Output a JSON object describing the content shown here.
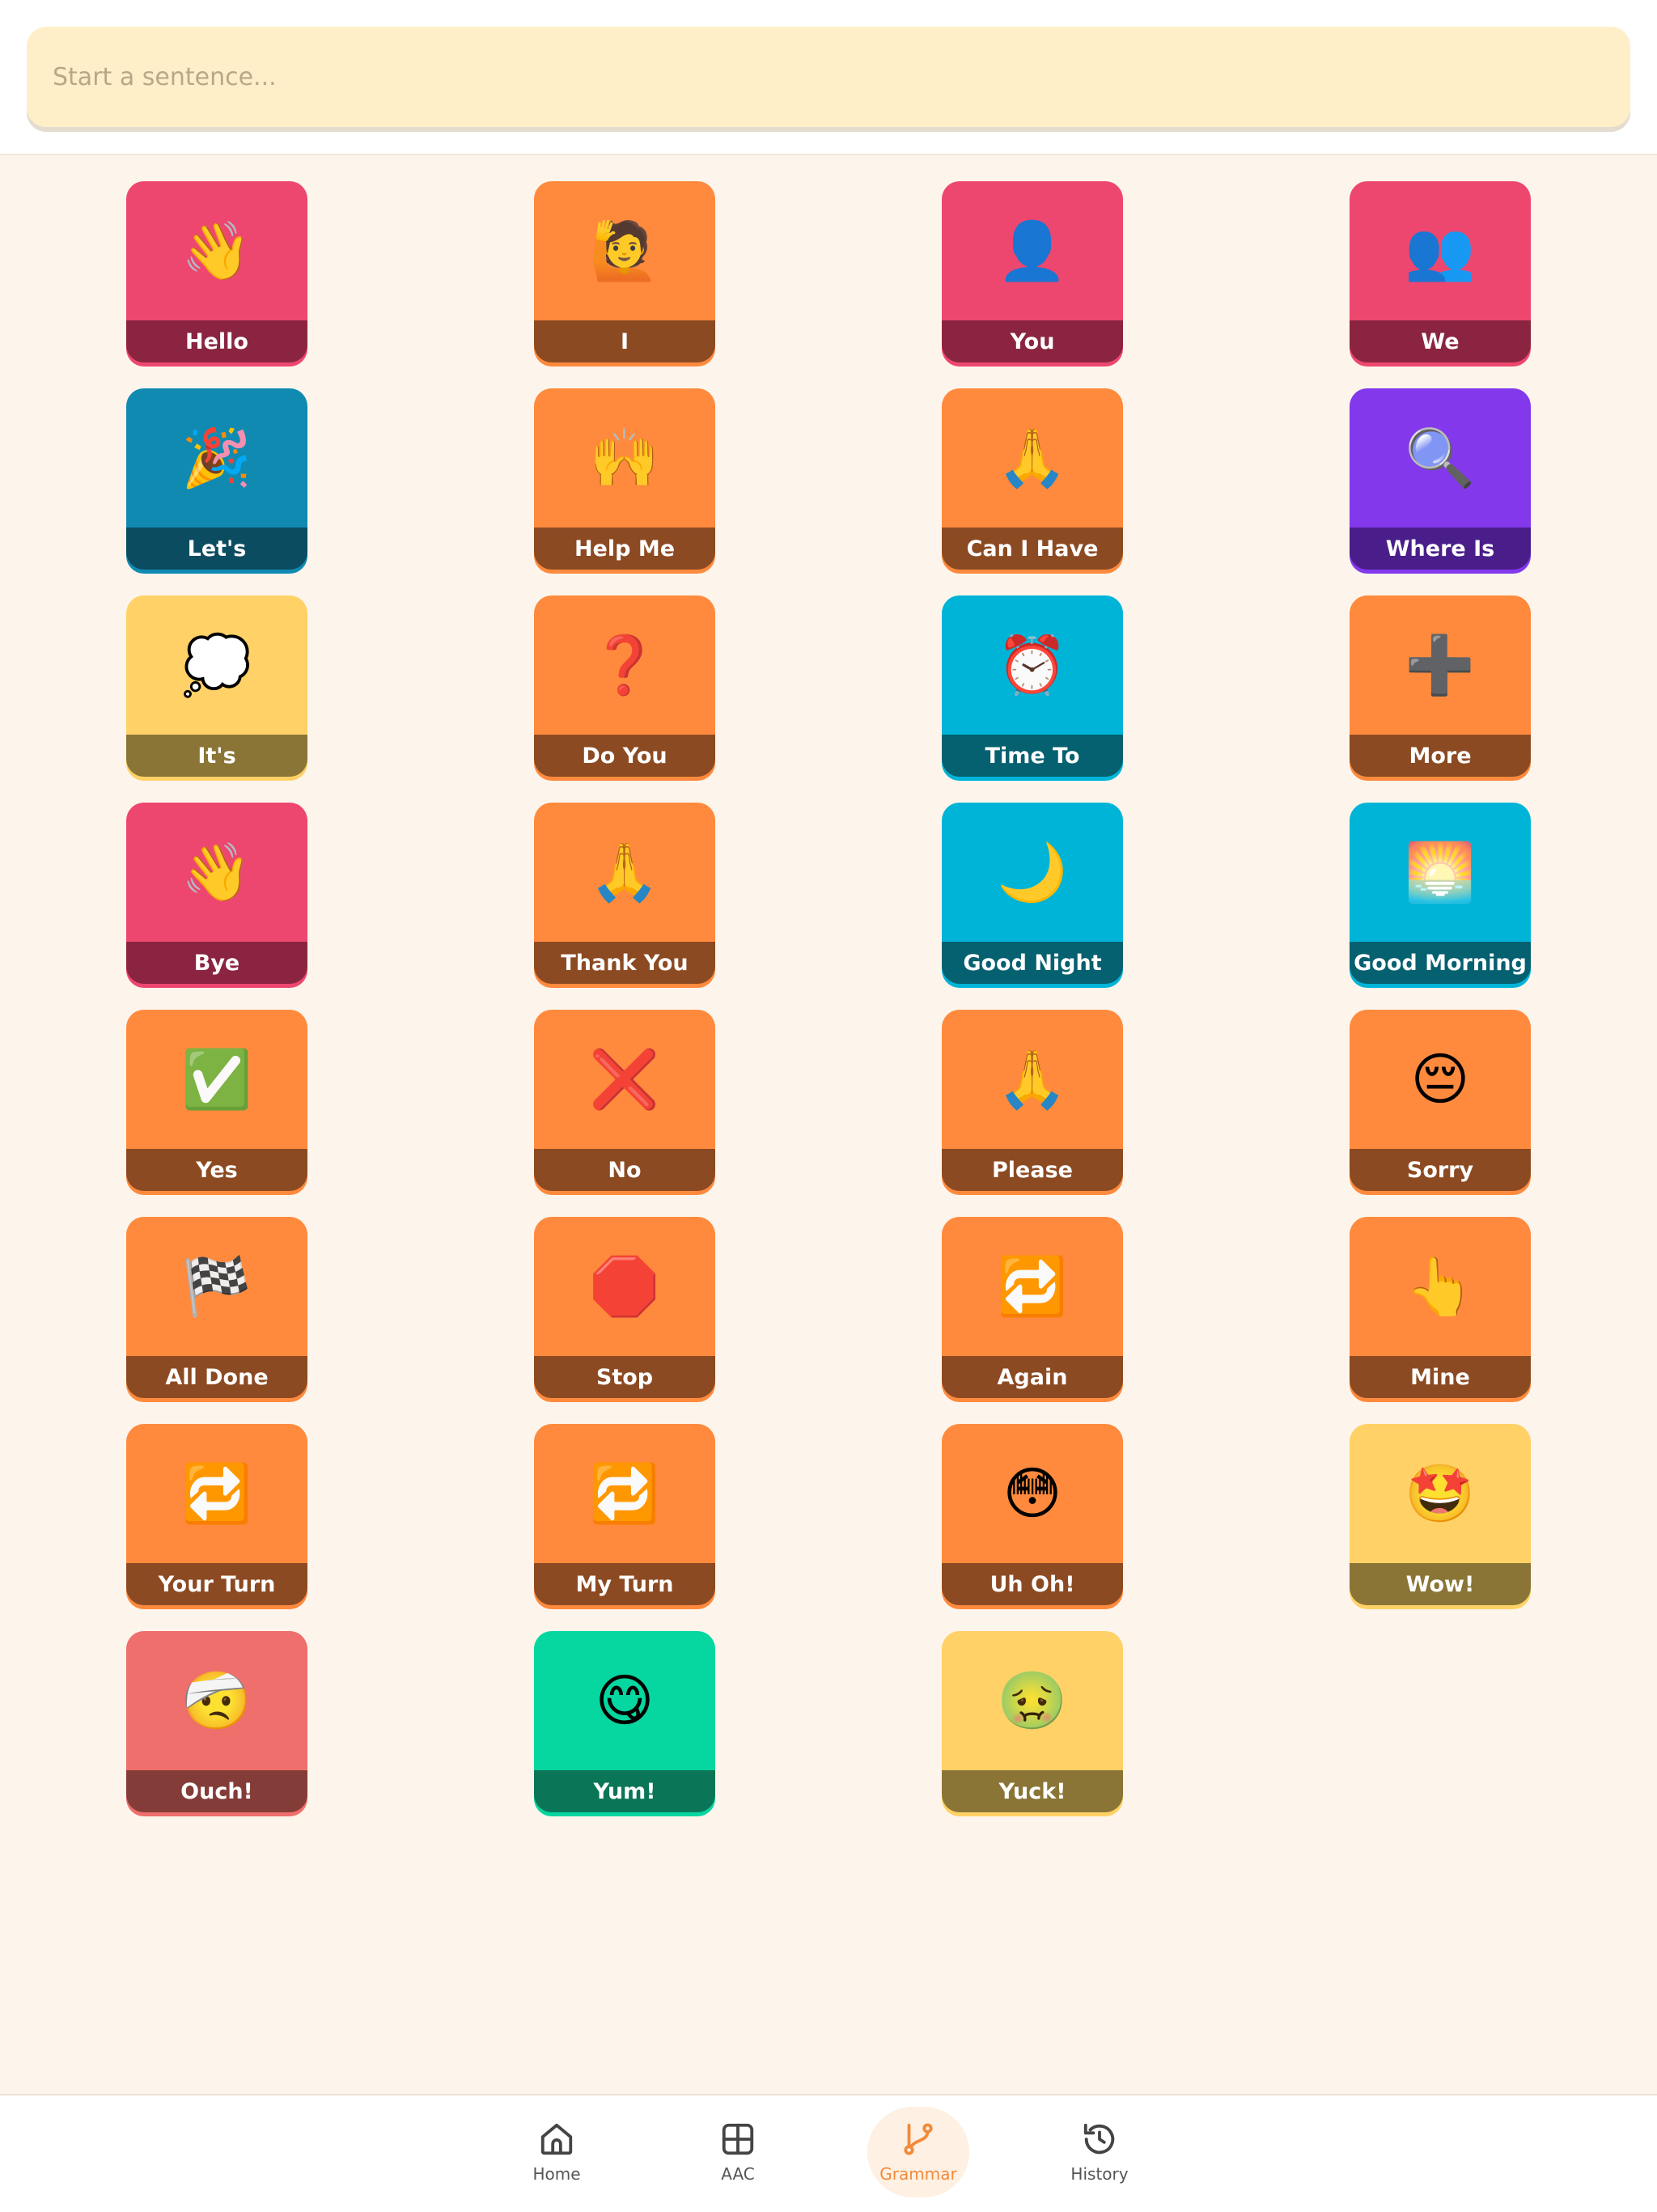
{
  "sentence_bar": {
    "placeholder": "Start a sentence..."
  },
  "tiles": [
    {
      "label": "Hello",
      "icon": "👋",
      "icon_name": "waving-hand-icon",
      "color": "#EE476F",
      "band": "#8A2440"
    },
    {
      "label": "I",
      "icon": "🙋",
      "icon_name": "person-raising-hand-icon",
      "color": "#FF8A3D",
      "band": "#8C4A22"
    },
    {
      "label": "You",
      "icon": "👤",
      "icon_name": "bust-silhouette-icon",
      "color": "#EE476F",
      "band": "#8A2440"
    },
    {
      "label": "We",
      "icon": "👥",
      "icon_name": "busts-silhouette-icon",
      "color": "#EE476F",
      "band": "#8A2440"
    },
    {
      "label": "Let's",
      "icon": "🎉",
      "icon_name": "party-popper-icon",
      "color": "#118AB2",
      "band": "#0B4C61"
    },
    {
      "label": "Help Me",
      "icon": "🙌",
      "icon_name": "raised-hands-icon",
      "color": "#FF8A3D",
      "band": "#8C4A22"
    },
    {
      "label": "Can I Have",
      "icon": "🙏",
      "icon_name": "folded-hands-icon",
      "color": "#FF8A3D",
      "band": "#8C4A22"
    },
    {
      "label": "Where Is",
      "icon": "🔍",
      "icon_name": "magnifying-glass-icon",
      "color": "#8338EC",
      "band": "#4A1E8A"
    },
    {
      "label": "It's",
      "icon": "💭",
      "icon_name": "thought-balloon-icon",
      "color": "#FFD166",
      "band": "#8A7536"
    },
    {
      "label": "Do You",
      "icon": "❓",
      "icon_name": "question-mark-icon",
      "color": "#FF8A3D",
      "band": "#8C4A22"
    },
    {
      "label": "Time To",
      "icon": "⏰",
      "icon_name": "alarm-clock-icon",
      "color": "#00B4D8",
      "band": "#05606F"
    },
    {
      "label": "More",
      "icon": "➕",
      "icon_name": "plus-icon",
      "color": "#FF8A3D",
      "band": "#8C4A22"
    },
    {
      "label": "Bye",
      "icon": "👋",
      "icon_name": "waving-hand-icon",
      "color": "#EE476F",
      "band": "#8A2440"
    },
    {
      "label": "Thank You",
      "icon": "🙏",
      "icon_name": "folded-hands-icon",
      "color": "#FF8A3D",
      "band": "#8C4A22"
    },
    {
      "label": "Good Night",
      "icon": "🌙",
      "icon_name": "crescent-moon-icon",
      "color": "#00B4D8",
      "band": "#05606F"
    },
    {
      "label": "Good Morning",
      "icon": "🌅",
      "icon_name": "sunrise-icon",
      "color": "#00B4D8",
      "band": "#05606F"
    },
    {
      "label": "Yes",
      "icon": "✅",
      "icon_name": "check-mark-button-icon",
      "color": "#FF8A3D",
      "band": "#8C4A22"
    },
    {
      "label": "No",
      "icon": "❌",
      "icon_name": "cross-mark-icon",
      "color": "#FF8A3D",
      "band": "#8C4A22"
    },
    {
      "label": "Please",
      "icon": "🙏",
      "icon_name": "folded-hands-icon",
      "color": "#FF8A3D",
      "band": "#8C4A22"
    },
    {
      "label": "Sorry",
      "icon": "😔",
      "icon_name": "pensive-face-icon",
      "color": "#FF8A3D",
      "band": "#8C4A22"
    },
    {
      "label": "All Done",
      "icon": "🏁",
      "icon_name": "chequered-flag-icon",
      "color": "#FF8A3D",
      "band": "#8C4A22"
    },
    {
      "label": "Stop",
      "icon": "🛑",
      "icon_name": "stop-sign-icon",
      "color": "#FF8A3D",
      "band": "#8C4A22"
    },
    {
      "label": "Again",
      "icon": "🔁",
      "icon_name": "repeat-button-icon",
      "color": "#FF8A3D",
      "band": "#8C4A22"
    },
    {
      "label": "Mine",
      "icon": "👆",
      "icon_name": "pointing-up-hand-icon",
      "color": "#FF8A3D",
      "band": "#8C4A22"
    },
    {
      "label": "Your Turn",
      "icon": "🔁",
      "icon_name": "repeat-button-icon",
      "color": "#FF8A3D",
      "band": "#8C4A22"
    },
    {
      "label": "My Turn",
      "icon": "🔁",
      "icon_name": "repeat-button-icon",
      "color": "#FF8A3D",
      "band": "#8C4A22"
    },
    {
      "label": "Uh Oh!",
      "icon": "😳",
      "icon_name": "flushed-face-icon",
      "color": "#FF8A3D",
      "band": "#8C4A22"
    },
    {
      "label": "Wow!",
      "icon": "🤩",
      "icon_name": "star-struck-face-icon",
      "color": "#FFD166",
      "band": "#8A7536"
    },
    {
      "label": "Ouch!",
      "icon": "🤕",
      "icon_name": "head-bandage-face-icon",
      "color": "#EF6F6C",
      "band": "#843C39"
    },
    {
      "label": "Yum!",
      "icon": "😋",
      "icon_name": "savoring-food-face-icon",
      "color": "#06D6A0",
      "band": "#0A7557"
    },
    {
      "label": "Yuck!",
      "icon": "🤢",
      "icon_name": "nauseated-face-icon",
      "color": "#FFD166",
      "band": "#8A7536"
    }
  ],
  "nav": {
    "items": [
      {
        "label": "Home",
        "icon_name": "home-icon",
        "active": false
      },
      {
        "label": "AAC",
        "icon_name": "grid-icon",
        "active": false
      },
      {
        "label": "Grammar",
        "icon_name": "branch-icon",
        "active": true
      },
      {
        "label": "History",
        "icon_name": "history-icon",
        "active": false
      }
    ],
    "active_color": "#F28A3B"
  }
}
